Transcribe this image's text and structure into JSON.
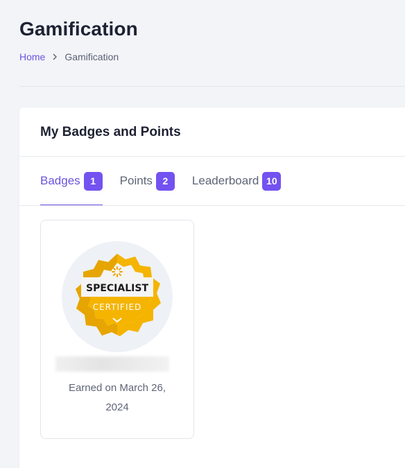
{
  "page": {
    "title": "Gamification"
  },
  "breadcrumb": {
    "home": "Home",
    "current": "Gamification"
  },
  "card": {
    "title": "My Badges and Points"
  },
  "tabs": [
    {
      "label": "Badges",
      "count": "1",
      "active": true
    },
    {
      "label": "Points",
      "count": "2",
      "active": false
    },
    {
      "label": "Leaderboard",
      "count": "10",
      "active": false
    }
  ],
  "badge": {
    "top_text": "SPECIALIST",
    "bottom_text": "CERTIFIED",
    "earned": "Earned on March 26, 2024",
    "colors": {
      "gold": "#f5b400",
      "gold_dark": "#e2a300",
      "ribbon": "#ffffff"
    }
  },
  "colors": {
    "accent": "#6b53e0",
    "count_badge": "#7352f0"
  }
}
